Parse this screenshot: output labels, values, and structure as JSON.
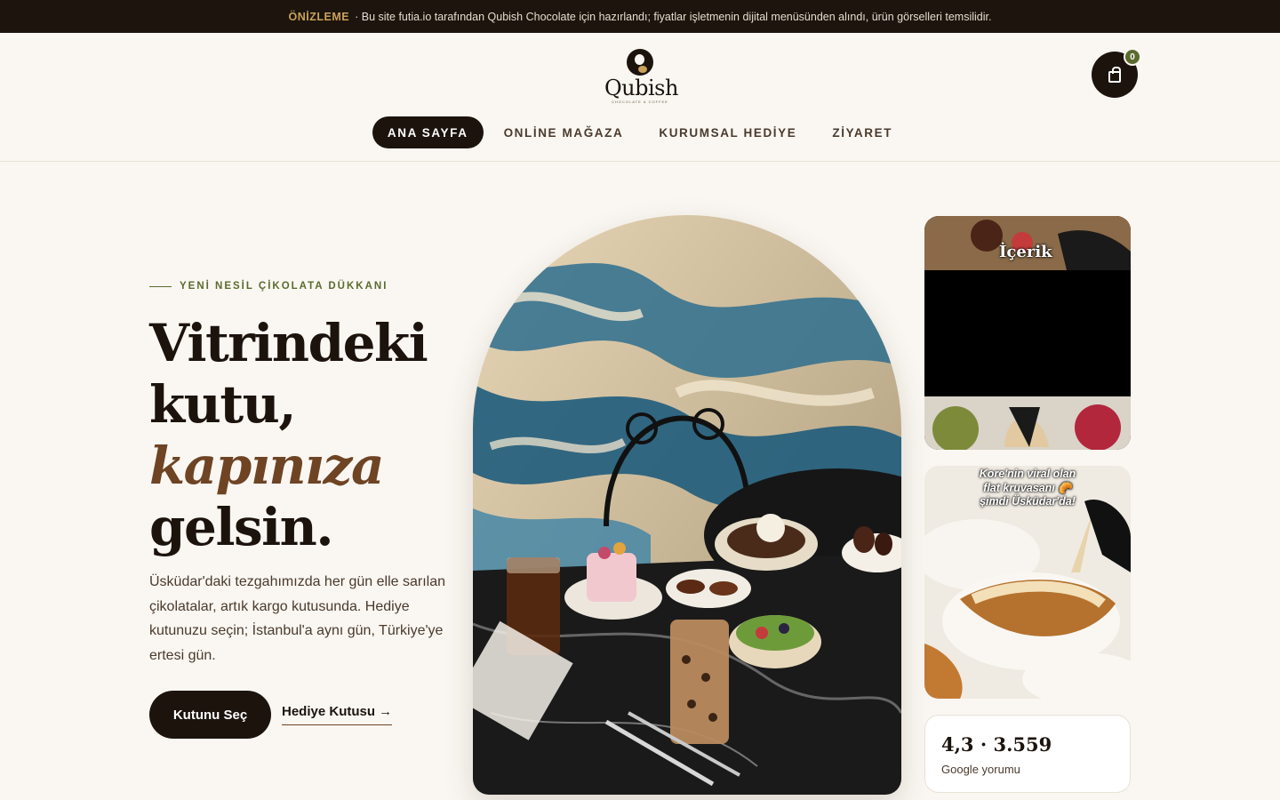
{
  "topbar": {
    "tag": "ÖNİZLEME",
    "text": "· Bu site futia.io tarafından Qubish Chocolate için hazırlandı; fiyatlar işletmenin dijital menüsünden alındı, ürün görselleri temsilidir."
  },
  "header": {
    "logo_text": "Qubish",
    "logo_sub": "CHOCOLATE & COFFEE",
    "cart_count": "0"
  },
  "nav": {
    "items": [
      {
        "label": "ANA SAYFA",
        "active": true
      },
      {
        "label": "ONLİNE MAĞAZA",
        "active": false
      },
      {
        "label": "KURUMSAL HEDİYE",
        "active": false
      },
      {
        "label": "ZİYARET",
        "active": false
      }
    ]
  },
  "hero": {
    "eyebrow": "YENİ NESİL ÇİKOLATA DÜKKANI",
    "headline": [
      "Vitrindeki",
      "kutu,",
      "kapınıza",
      "gelsin."
    ],
    "description": "Üsküdar'daki tezgahımızda her gün elle sarılan çikolatalar, artık kargo kutusunda. Hediye kutunuzu seçin; İstanbul'a aynı gün, Türkiye'ye ertesi gün.",
    "primary_cta": "Kutunu Seç",
    "secondary_cta": "Hediye Kutusu →"
  },
  "side": {
    "card1_caption": "İçerik",
    "card2_caption": [
      "Kore'nin viral olan",
      "flat kruvasanı 🥐",
      "şimdi Üsküdar'da!"
    ],
    "rating_value": "4,3 · 3.559",
    "rating_label": "Google yorumu"
  },
  "colors": {
    "dark": "#1c130d",
    "accent_brown": "#6e4424",
    "olive": "#5a6b2e",
    "gold": "#c9a15a",
    "background": "#faf7f2"
  },
  "icons": [
    "shopping-bag-icon",
    "arrow-right-icon"
  ]
}
